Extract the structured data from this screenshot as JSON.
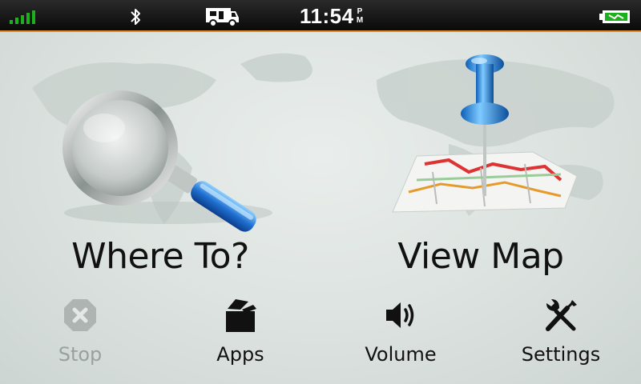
{
  "status_bar": {
    "time": "11:54",
    "ampm_top": "P",
    "ampm_bottom": "M",
    "signal_color": "#1db01d",
    "battery_color": "#1db01d",
    "accent_line_color": "#e08a1e"
  },
  "main": {
    "where_to_label": "Where To?",
    "view_map_label": "View Map"
  },
  "bottom": {
    "stop_label": "Stop",
    "apps_label": "Apps",
    "volume_label": "Volume",
    "settings_label": "Settings"
  }
}
